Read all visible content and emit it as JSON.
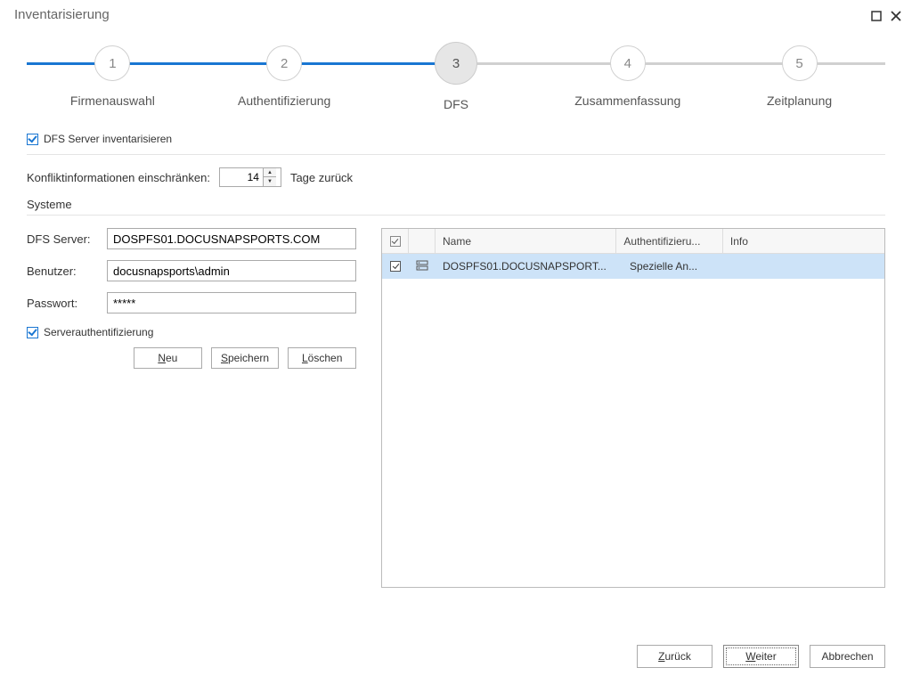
{
  "title": "Inventarisierung",
  "steps": [
    {
      "num": "1",
      "label": "Firmenauswahl"
    },
    {
      "num": "2",
      "label": "Authentifizierung"
    },
    {
      "num": "3",
      "label": "DFS"
    },
    {
      "num": "4",
      "label": "Zusammenfassung"
    },
    {
      "num": "5",
      "label": "Zeitplanung"
    }
  ],
  "dfs_checkbox_label": "DFS Server inventarisieren",
  "conflict_label": "Konfliktinformationen einschränken:",
  "conflict_value": "14",
  "conflict_suffix": "Tage zurück",
  "systems_header": "Systeme",
  "form": {
    "server_label": "DFS Server:",
    "server_value": "DOSPFS01.DOCUSNAPSPORTS.COM",
    "user_label": "Benutzer:",
    "user_value": "docusnapsports\\admin",
    "pass_label": "Passwort:",
    "pass_value": "*****",
    "serverauth_label": "Serverauthentifizierung"
  },
  "buttons": {
    "new": "Neu",
    "save": "Speichern",
    "delete": "Löschen"
  },
  "grid": {
    "headers": {
      "name": "Name",
      "auth": "Authentifizieru...",
      "info": "Info"
    },
    "rows": [
      {
        "checked": true,
        "name": "DOSPFS01.DOCUSNAPSPORT...",
        "auth": "Spezielle An...",
        "info": ""
      }
    ]
  },
  "footer": {
    "back": "Zurück",
    "next": "Weiter",
    "cancel": "Abbrechen"
  }
}
